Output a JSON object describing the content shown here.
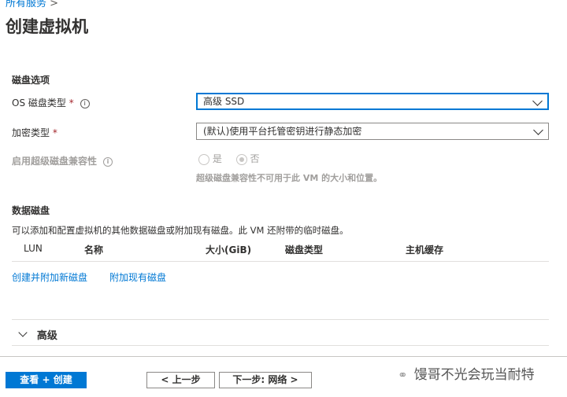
{
  "breadcrumb": {
    "item": "所有服务",
    "separator": ">"
  },
  "title": "创建虚拟机",
  "disk_options": {
    "heading": "磁盘选项",
    "os_disk_type": {
      "label": "OS 磁盘类型",
      "required": "*",
      "value": "高级 SSD"
    },
    "encryption": {
      "label": "加密类型",
      "required": "*",
      "value": "(默认)使用平台托管密钥进行静态加密"
    },
    "ultra": {
      "label": "启用超级磁盘兼容性",
      "options": [
        "是",
        "否"
      ],
      "selected": "否",
      "note": "超级磁盘兼容性不可用于此 VM 的大小和位置。"
    }
  },
  "data_disks": {
    "heading": "数据磁盘",
    "description": "可以添加和配置虚拟机的其他数据磁盘或附加现有磁盘。此 VM 还附带的临时磁盘。",
    "columns": [
      "LUN",
      "名称",
      "大小(GiB)",
      "磁盘类型",
      "主机缓存"
    ],
    "create_link": "创建并附加新磁盘",
    "attach_link": "附加现有磁盘"
  },
  "advanced": {
    "label": "高级"
  },
  "footer": {
    "review_create": "查看 + 创建",
    "previous": "< 上一步",
    "next": "下一步: 网络 >"
  },
  "watermark": "馒哥不光会玩当耐特",
  "colors": {
    "accent": "#0078d4",
    "required": "#a4262c"
  }
}
